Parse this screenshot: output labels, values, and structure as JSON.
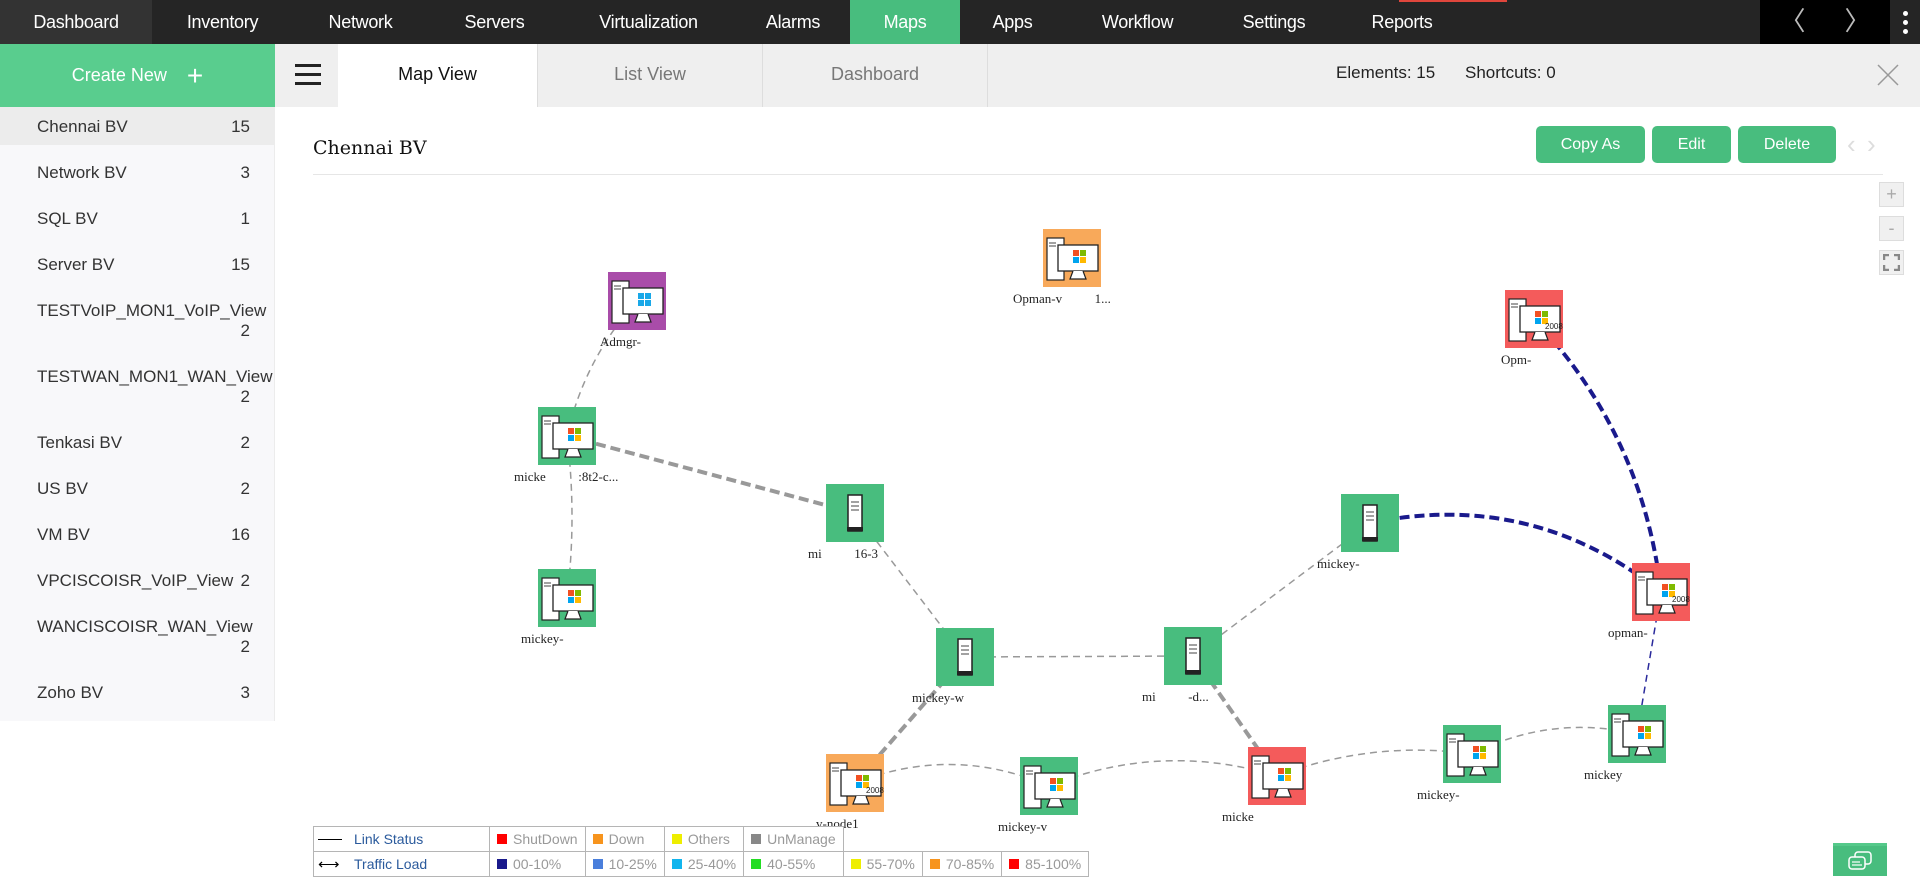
{
  "topnav": {
    "items": [
      {
        "label": "Dashboard"
      },
      {
        "label": "Inventory"
      },
      {
        "label": "Network"
      },
      {
        "label": "Servers"
      },
      {
        "label": "Virtualization"
      },
      {
        "label": "Alarms"
      },
      {
        "label": "Maps",
        "active": true
      },
      {
        "label": "Apps"
      },
      {
        "label": "Workflow"
      },
      {
        "label": "Settings"
      },
      {
        "label": "Reports"
      }
    ],
    "prev_icon": "〈",
    "next_icon": "〉",
    "active_color": "#48bd7e"
  },
  "sidebar": {
    "create_new_label": "Create New",
    "create_new_icon": "+",
    "items": [
      {
        "label": "Chennai BV",
        "count": "15",
        "active": true
      },
      {
        "label": "Network BV",
        "count": "3"
      },
      {
        "label": "SQL BV",
        "count": "1"
      },
      {
        "label": "Server BV",
        "count": "15"
      },
      {
        "label": "TESTVoIP_MON1_VoIP_View",
        "count": "2"
      },
      {
        "label": "TESTWAN_MON1_WAN_View",
        "count": "2"
      },
      {
        "label": "Tenkasi BV",
        "count": "2"
      },
      {
        "label": "US BV",
        "count": "2"
      },
      {
        "label": "VM BV",
        "count": "16"
      },
      {
        "label": "VPCISCOISR_VoIP_View",
        "count": "2"
      },
      {
        "label": "WANCISCOISR_WAN_View",
        "count": "2"
      },
      {
        "label": "Zoho BV",
        "count": "3"
      }
    ]
  },
  "tabs": {
    "items": [
      {
        "label": "Map View",
        "active": true
      },
      {
        "label": "List View"
      },
      {
        "label": "Dashboard"
      }
    ],
    "elements_text": "Elements: 15",
    "shortcuts_text": "Shortcuts: 0"
  },
  "main": {
    "title": "Chennai BV",
    "buttons": {
      "copy_as": "Copy As",
      "edit": "Edit",
      "delete": "Delete"
    },
    "pager": {
      "prev": "‹",
      "next": "›"
    },
    "zoom": {
      "in": "+",
      "out": "-"
    }
  },
  "map": {
    "status_colors": {
      "clear": "#48bd7e",
      "down": "#f8a95a",
      "critical": "#f45b5b",
      "attention": "#a94ca9"
    },
    "nodes": [
      {
        "id": "admgr",
        "type": "windows-server",
        "status": "attention",
        "os": "win10",
        "label": "Admgr-"
      },
      {
        "id": "opman-v",
        "type": "windows-server",
        "status": "down",
        "os": "winxp",
        "label": "Opman-v          1..."
      },
      {
        "id": "opm",
        "type": "windows-server",
        "status": "critical",
        "os": "win2008",
        "label": "Opm-"
      },
      {
        "id": "mickey-8t2",
        "type": "windows-server",
        "status": "clear",
        "os": "winxp",
        "label": "micke          :8t2-c..."
      },
      {
        "id": "mickey-a",
        "type": "windows-server",
        "status": "clear",
        "os": "winxp",
        "label": "mickey-"
      },
      {
        "id": "mi-16-3",
        "type": "server",
        "status": "clear",
        "label": "mi          16-3"
      },
      {
        "id": "mickey-w",
        "type": "server",
        "status": "clear",
        "label": "mickey-w"
      },
      {
        "id": "mi-d",
        "type": "server",
        "status": "clear",
        "label": "mi          -d..."
      },
      {
        "id": "mickey-b",
        "type": "server",
        "status": "clear",
        "label": "mickey-"
      },
      {
        "id": "opman-2008",
        "type": "windows-server",
        "status": "critical",
        "os": "win2008",
        "label": "opman-"
      },
      {
        "id": "node1",
        "type": "windows-server",
        "status": "down",
        "os": "win2008",
        "label": "v-node1"
      },
      {
        "id": "mickey-v",
        "type": "windows-server",
        "status": "clear",
        "os": "winxp",
        "label": "mickey-v"
      },
      {
        "id": "micke",
        "type": "windows-server",
        "status": "critical",
        "os": "winxp",
        "label": "micke"
      },
      {
        "id": "mickey-c",
        "type": "windows-server",
        "status": "clear",
        "os": "winxp",
        "label": "mickey-"
      },
      {
        "id": "mickey-d",
        "type": "windows-server",
        "status": "clear",
        "os": "winxp",
        "label": "mickey"
      }
    ],
    "links": [
      {
        "from": "admgr",
        "to": "mickey-8t2",
        "style": "thin"
      },
      {
        "from": "mickey-8t2",
        "to": "mickey-a",
        "style": "thin"
      },
      {
        "from": "mickey-8t2",
        "to": "mi-16-3",
        "style": "thick"
      },
      {
        "from": "mi-16-3",
        "to": "mickey-w",
        "style": "thin"
      },
      {
        "from": "mickey-w",
        "to": "mi-d",
        "style": "thin"
      },
      {
        "from": "mickey-w",
        "to": "node1",
        "style": "thick"
      },
      {
        "from": "mi-d",
        "to": "mickey-b",
        "style": "thin"
      },
      {
        "from": "mi-d",
        "to": "micke",
        "style": "thick"
      },
      {
        "from": "mickey-b",
        "to": "opman-2008",
        "style": "traffic"
      },
      {
        "from": "opm",
        "to": "opman-2008",
        "style": "traffic"
      },
      {
        "from": "opman-2008",
        "to": "mickey-d",
        "style": "traffic-thin"
      },
      {
        "from": "node1",
        "to": "mickey-v",
        "style": "thin"
      },
      {
        "from": "mickey-v",
        "to": "micke",
        "style": "thin"
      },
      {
        "from": "micke",
        "to": "mickey-c",
        "style": "thin"
      },
      {
        "from": "mickey-c",
        "to": "mickey-d",
        "style": "thin"
      }
    ]
  },
  "legend": {
    "link_status_label": "Link Status",
    "traffic_load_label": "Traffic Load",
    "link_status": [
      {
        "label": "ShutDown",
        "color": "#ff0000"
      },
      {
        "label": "Down",
        "color": "#f7941d"
      },
      {
        "label": "Others",
        "color": "#eeee00"
      },
      {
        "label": "UnManage",
        "color": "#888888"
      }
    ],
    "traffic_load": [
      {
        "label": "00-10%",
        "color": "#1a1a8c"
      },
      {
        "label": "10-25%",
        "color": "#4a7fdc"
      },
      {
        "label": "25-40%",
        "color": "#11b5ee"
      },
      {
        "label": "40-55%",
        "color": "#22dd22"
      },
      {
        "label": "55-70%",
        "color": "#eeee00"
      },
      {
        "label": "70-85%",
        "color": "#f7941d"
      },
      {
        "label": "85-100%",
        "color": "#ff0000"
      }
    ]
  }
}
